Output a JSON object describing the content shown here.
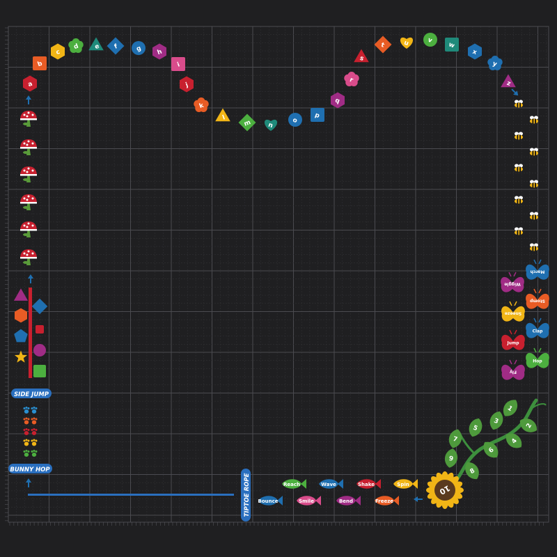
{
  "letters": [
    "a",
    "b",
    "c",
    "d",
    "e",
    "f",
    "g",
    "h",
    "i",
    "j",
    "k",
    "l",
    "m",
    "n",
    "o",
    "p",
    "q",
    "r",
    "s",
    "t",
    "u",
    "v",
    "w",
    "x",
    "y",
    "z"
  ],
  "labels": {
    "side_jump": "SIDE JUMP",
    "bunny_hop": "BUNNY HOP",
    "tiptoe_rope": "TIPTOE ROPE"
  },
  "fish": [
    "Bounce",
    "Reach",
    "Smile",
    "Wave",
    "Bend",
    "Shake",
    "Freeze",
    "Spin"
  ],
  "butterflies": [
    "Wiggle",
    "March",
    "Stomp",
    "Sneeze",
    "Clap",
    "Jump",
    "Hop",
    "Fly"
  ],
  "leaves": [
    "1",
    "2",
    "3",
    "4",
    "5",
    "6",
    "7",
    "8",
    "9"
  ],
  "sunflower_number": "10",
  "colors": {
    "background": "#1f1f21",
    "grid": "#3a3a3d",
    "red": "#c8202f",
    "orange": "#e85c25",
    "yellow": "#f1b516",
    "green": "#4caf3f",
    "teal": "#1f8a7a",
    "blue": "#1f6fb0",
    "purple": "#a02c85",
    "pink": "#d94c8b",
    "rope": "#2a6fbf"
  }
}
